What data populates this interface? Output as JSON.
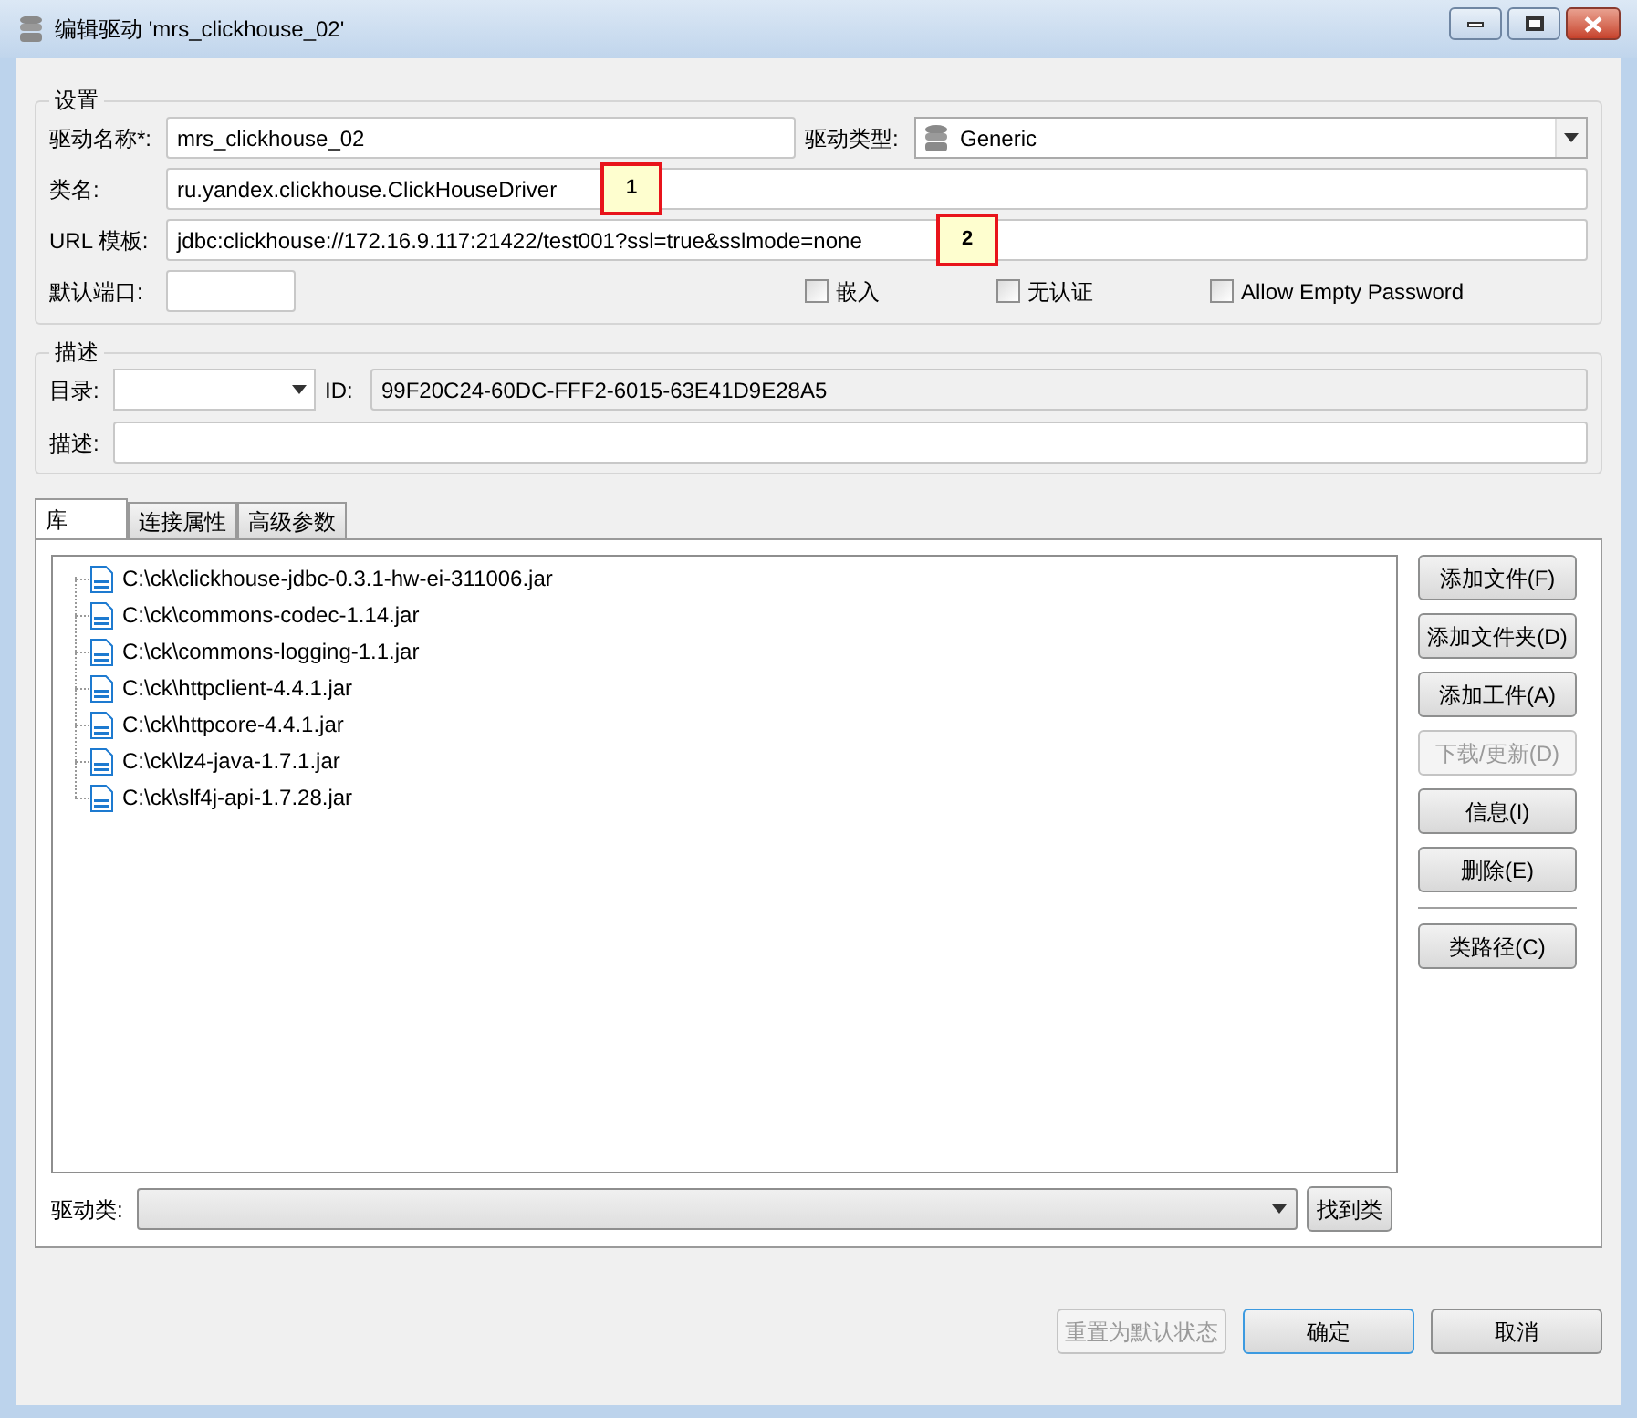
{
  "window": {
    "title": "编辑驱动 'mrs_clickhouse_02'"
  },
  "settings": {
    "legend": "设置",
    "driver_name": {
      "label": "驱动名称*:",
      "value": "mrs_clickhouse_02"
    },
    "driver_type": {
      "label": "驱动类型:",
      "value": "Generic"
    },
    "class_name": {
      "label": "类名:",
      "value": "ru.yandex.clickhouse.ClickHouseDriver",
      "callout": "1"
    },
    "url_template": {
      "label": "URL 模板:",
      "value": "jdbc:clickhouse://172.16.9.117:21422/test001?ssl=true&sslmode=none",
      "callout": "2"
    },
    "default_port": {
      "label": "默认端口:"
    },
    "checkboxes": [
      {
        "label": "嵌入",
        "checked": false
      },
      {
        "label": "无认证",
        "checked": false
      },
      {
        "label": "Allow Empty Password",
        "checked": false
      }
    ]
  },
  "description": {
    "legend": "描述",
    "category": {
      "label": "目录:"
    },
    "id": {
      "label": "ID:",
      "value": "99F20C24-60DC-FFF2-6015-63E41D9E28A5"
    },
    "text": {
      "label": "描述:"
    }
  },
  "tabs": [
    {
      "label": "库",
      "selected": true
    },
    {
      "label": "连接属性",
      "selected": false
    },
    {
      "label": "高级参数",
      "selected": false
    }
  ],
  "libraries": [
    {
      "path": "C:\\ck\\clickhouse-jdbc-0.3.1-hw-ei-311006.jar"
    },
    {
      "path": "C:\\ck\\commons-codec-1.14.jar"
    },
    {
      "path": "C:\\ck\\commons-logging-1.1.jar"
    },
    {
      "path": "C:\\ck\\httpclient-4.4.1.jar"
    },
    {
      "path": "C:\\ck\\httpcore-4.4.1.jar"
    },
    {
      "path": "C:\\ck\\lz4-java-1.7.1.jar"
    },
    {
      "path": "C:\\ck\\slf4j-api-1.7.28.jar"
    }
  ],
  "side_buttons": [
    {
      "label": "添加文件(F)",
      "disabled": false
    },
    {
      "label": "添加文件夹(D)",
      "disabled": false
    },
    {
      "label": "添加工件(A)",
      "disabled": false
    },
    {
      "label": "下载/更新(D)",
      "disabled": true
    },
    {
      "label": "信息(I)",
      "disabled": false
    },
    {
      "label": "删除(E)",
      "disabled": false
    }
  ],
  "side_buttons_lower": [
    {
      "label": "类路径(C)",
      "disabled": false
    }
  ],
  "driver_class": {
    "label": "驱动类:",
    "button": "找到类"
  },
  "footer_buttons": [
    {
      "label": "重置为默认状态",
      "disabled": true,
      "default": false
    },
    {
      "label": "确定",
      "disabled": false,
      "default": true
    },
    {
      "label": "取消",
      "disabled": false,
      "default": false
    }
  ]
}
